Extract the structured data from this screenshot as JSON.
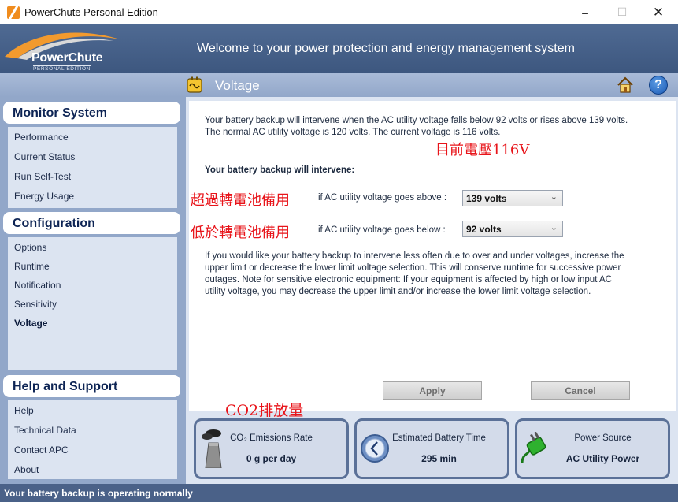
{
  "window": {
    "title": "PowerChute Personal Edition",
    "controls": {
      "minimize": "–",
      "maximize": "☐",
      "close": "✕"
    }
  },
  "banner": {
    "logo_main": "PowerChute",
    "logo_sub": "PERSONAL EDITION",
    "welcome": "Welcome to your power protection and energy management system"
  },
  "section": {
    "title": "Voltage",
    "icons": [
      "voltage-icon",
      "home-icon",
      "help-icon"
    ],
    "help_glyph": "?"
  },
  "sidebar": {
    "monitor": {
      "title": "Monitor System",
      "items": [
        "Performance",
        "Current Status",
        "Run Self-Test",
        "Energy Usage"
      ]
    },
    "configuration": {
      "title": "Configuration",
      "items": [
        "Options",
        "Runtime",
        "Notification",
        "Sensitivity",
        "Voltage"
      ],
      "active": "Voltage"
    },
    "help": {
      "title": "Help and Support",
      "items": [
        "Help",
        "Technical Data",
        "Contact APC",
        "About"
      ]
    }
  },
  "content": {
    "intro_line1": "Your battery backup will intervene when the AC utility voltage falls below 92 volts or rises above 139 volts.",
    "intro_line2": "The normal AC utility voltage is 120 volts. The current voltage is 116 volts.",
    "intervene_heading": "Your battery backup will intervene:",
    "above_label": "if AC utility voltage goes above :",
    "above_value": "139 volts",
    "below_label": "if AC utility voltage goes below :",
    "below_value": "92 volts",
    "advice": [
      "If you would like your battery backup to intervene less often due to over and under voltages, increase the",
      "upper limit or decrease the lower limit voltage selection. This will conserve runtime for successive power",
      "outages. Note for sensitive electronic equipment: If your equipment is affected by high or low input AC",
      "utility voltage, you may decrease the upper limit and/or increase the lower limit voltage selection."
    ],
    "apply_label": "Apply",
    "cancel_label": "Cancel"
  },
  "annotations": {
    "current_voltage": "目前電壓116V",
    "above": "超過轉電池備用",
    "below": "低於轉電池備用",
    "co2": "CO2排放量"
  },
  "cards": [
    {
      "title": "CO₂ Emissions Rate",
      "value": "0 g per day",
      "icon": "factory-icon"
    },
    {
      "title": "Estimated Battery Time",
      "value": "295 min",
      "icon": "clock-icon"
    },
    {
      "title": "Power Source",
      "value": "AC Utility Power",
      "icon": "plug-icon"
    }
  ],
  "status": {
    "text": "Your battery backup is operating normally"
  },
  "colors": {
    "banner": "#3d577f",
    "sidebar": "#92a7c9",
    "panel": "#dce4f1",
    "heading": "#0d2454",
    "annotation": "#e8141a"
  }
}
